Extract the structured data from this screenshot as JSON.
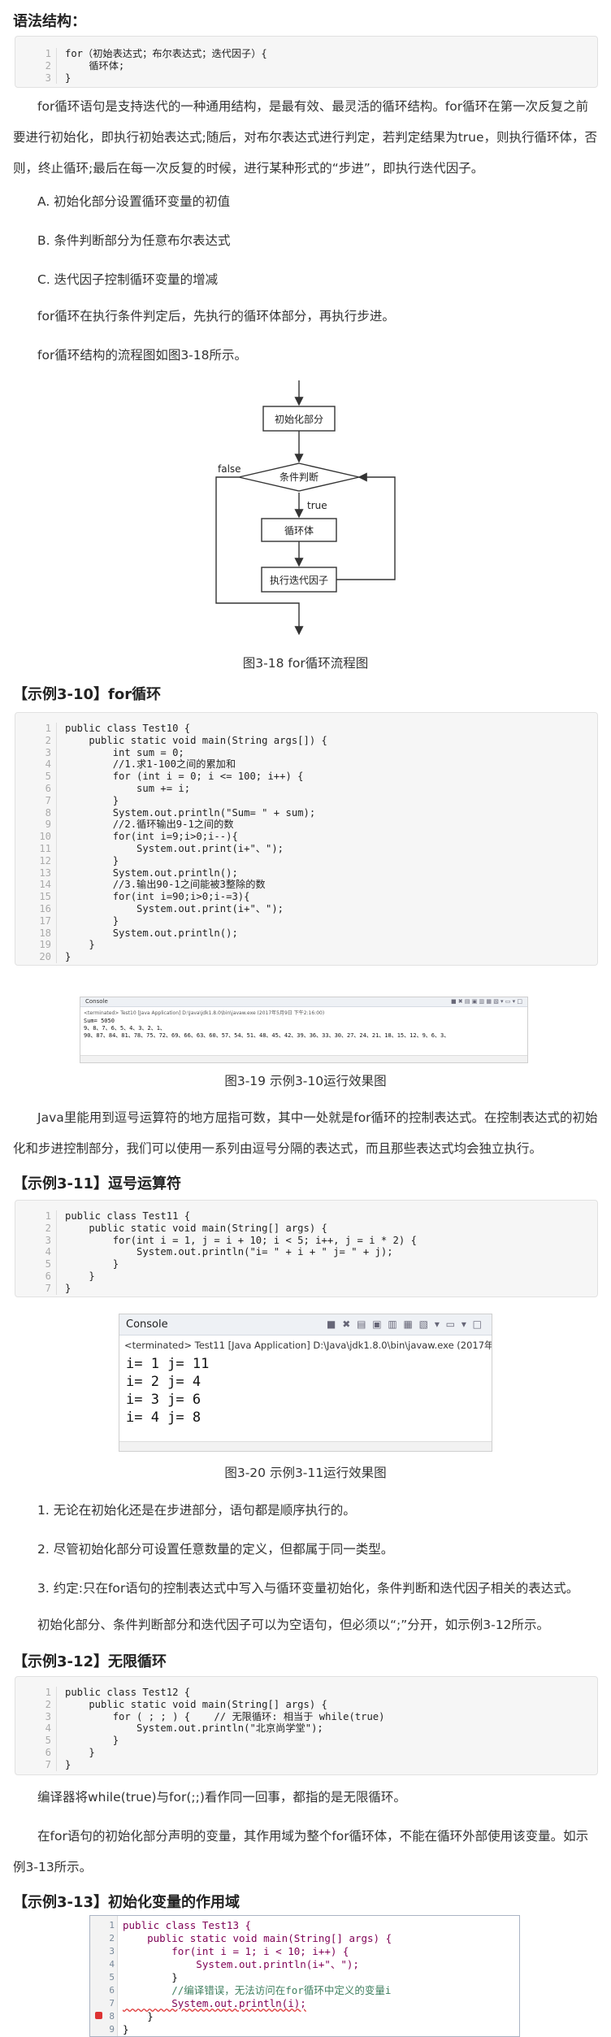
{
  "s1": {
    "heading": "语法结构：",
    "code": [
      "for（初始表达式；布尔表达式；迭代因子）{",
      "    循环体;",
      "}"
    ],
    "para1": "for循环语句是支持迭代的一种通用结构，是最有效、最灵活的循环结构。for循环在第一次反复之前要进行初始化，即执行初始表达式;随后，对布尔表达式进行判定，若判定结果为true，则执行循环体，否则，终止循环;最后在每一次反复的时候，进行某种形式的“步进”，即执行迭代因子。",
    "items": [
      "A. 初始化部分设置循环变量的初值",
      "B. 条件判断部分为任意布尔表达式",
      "C. 迭代因子控制循环变量的增减"
    ],
    "para2": "for循环在执行条件判定后，先执行的循环体部分，再执行步进。",
    "para3": "for循环结构的流程图如图3-18所示。"
  },
  "flow": {
    "init": "初始化部分",
    "cond": "条件判断",
    "body": "循环体",
    "step": "执行迭代因子",
    "false_label": "false",
    "true_label": "true",
    "caption": "图3-18 for循环流程图"
  },
  "ex10": {
    "heading": "【示例3-10】for循环",
    "code": [
      "public class Test10 {",
      "    public static void main(String args[]) {",
      "        int sum = 0;",
      "        //1.求1-100之间的累加和",
      "        for (int i = 0; i <= 100; i++) {",
      "            sum += i;",
      "        }",
      "        System.out.println(\"Sum= \" + sum);",
      "        //2.循环输出9-1之间的数",
      "        for(int i=9;i>0;i--){",
      "            System.out.print(i+\"、\");",
      "        }",
      "        System.out.println();",
      "        //3.输出90-1之间能被3整除的数",
      "        for(int i=90;i>0;i-=3){",
      "            System.out.print(i+\"、\");",
      "        }",
      "        System.out.println();",
      "    }",
      "}"
    ],
    "console": {
      "tab": "Console",
      "status": "<terminated> Test10 [Java Application] D:\\Java\\jdk1.8.0\\bin\\javaw.exe (2017年5月9日 下午2:16:00)",
      "output": [
        "Sum= 5050",
        "9、8、7、6、5、4、3、2、1、",
        "90、87、84、81、78、75、72、69、66、63、60、57、54、51、48、45、42、39、36、33、30、27、24、21、18、15、12、9、6、3、"
      ]
    },
    "caption": "图3-19 示例3-10运行效果图"
  },
  "s2": {
    "para": "Java里能用到逗号运算符的地方屈指可数，其中一处就是for循环的控制表达式。在控制表达式的初始化和步进控制部分，我们可以使用一系列由逗号分隔的表达式，而且那些表达式均会独立执行。"
  },
  "ex11": {
    "heading": "【示例3-11】逗号运算符",
    "code": [
      "public class Test11 {",
      "    public static void main(String[] args) {",
      "        for(int i = 1, j = i + 10; i < 5; i++, j = i * 2) {",
      "            System.out.println(\"i= \" + i + \" j= \" + j);",
      "        }",
      "    }",
      "}"
    ],
    "console": {
      "tab": "Console",
      "status": "<terminated> Test11 [Java Application] D:\\Java\\jdk1.8.0\\bin\\javaw.exe (2017年",
      "output": [
        "i= 1 j= 11",
        "i= 2 j= 4",
        "i= 3 j= 6",
        "i= 4 j= 8"
      ]
    },
    "caption": "图3-20 示例3-11运行效果图"
  },
  "s3": {
    "items": [
      "1. 无论在初始化还是在步进部分，语句都是顺序执行的。",
      "2. 尽管初始化部分可设置任意数量的定义，但都属于同一类型。",
      "3. 约定:只在for语句的控制表达式中写入与循环变量初始化，条件判断和迭代因子相关的表达式。"
    ],
    "para": "初始化部分、条件判断部分和迭代因子可以为空语句，但必须以“;”分开，如示例3-12所示。"
  },
  "ex12": {
    "heading": "【示例3-12】无限循环",
    "code": [
      "public class Test12 {",
      "    public static void main(String[] args) {",
      "        for ( ; ; ) {    // 无限循环: 相当于 while(true)",
      "            System.out.println(\"北京尚学堂\");",
      "        }",
      "    }",
      "}"
    ]
  },
  "s4": {
    "para1": "编译器将while(true)与for(;;)看作同一回事，都指的是无限循环。",
    "para2": "在for语句的初始化部分声明的变量，其作用域为整个for循环体，不能在循环外部使用该变量。如示例3-13所示。"
  },
  "ex13": {
    "heading": "【示例3-13】初始化变量的作用域",
    "code": [
      "public class Test13 {",
      "    public static void main(String[] args) {",
      "        for(int i = 1; i < 10; i++) {",
      "            System.out.println(i+\"、\");",
      "        }",
      "        //编译错误，无法访问在for循环中定义的变量i",
      "        System.out.println(i);",
      "    }",
      "}"
    ]
  }
}
